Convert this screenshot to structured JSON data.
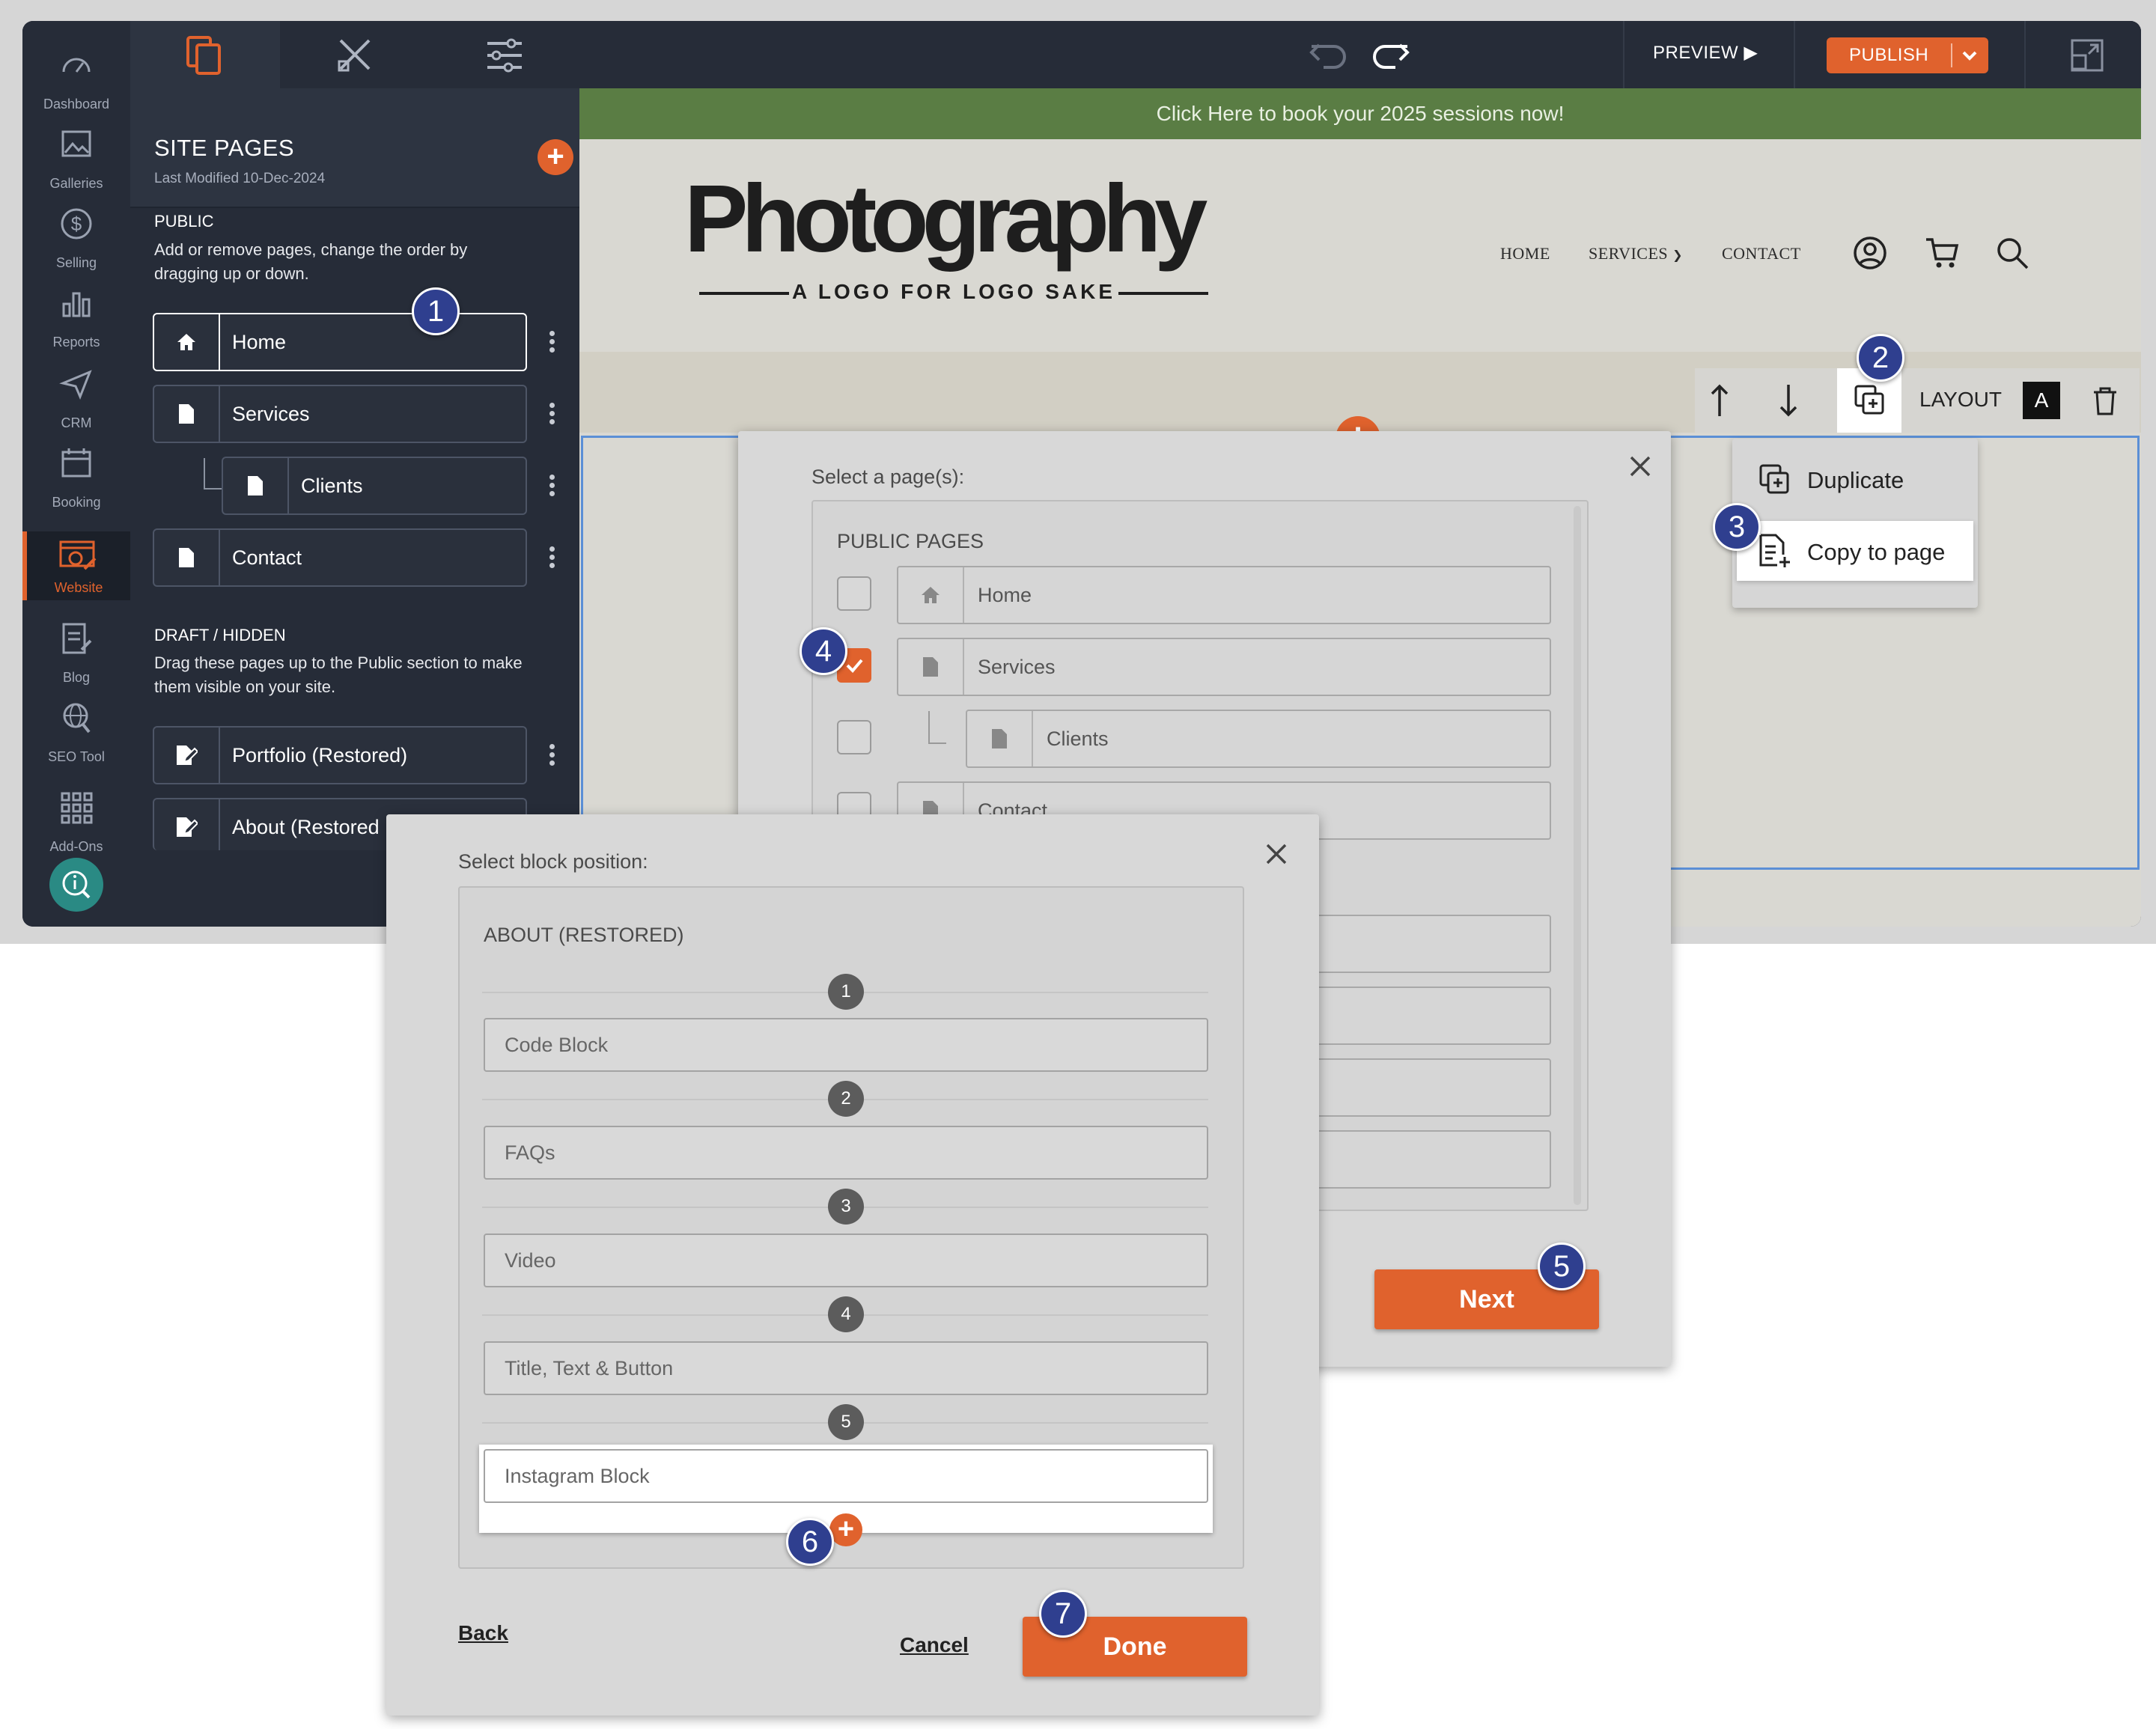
{
  "rail": {
    "items": [
      {
        "label": "Dashboard",
        "icon": "gauge-icon"
      },
      {
        "label": "Galleries",
        "icon": "image-icon"
      },
      {
        "label": "Selling",
        "icon": "dollar-icon"
      },
      {
        "label": "Reports",
        "icon": "bar-chart-icon"
      },
      {
        "label": "CRM",
        "icon": "send-icon"
      },
      {
        "label": "Booking",
        "icon": "calendar-icon"
      },
      {
        "label": "Website",
        "icon": "website-icon",
        "active": true
      },
      {
        "label": "Blog",
        "icon": "blog-icon"
      },
      {
        "label": "SEO Tool",
        "icon": "seo-icon"
      },
      {
        "label": "Add-Ons",
        "icon": "grid-icon"
      }
    ]
  },
  "topbar": {
    "preview_label": "PREVIEW ▶",
    "publish_label": "PUBLISH"
  },
  "sidebar": {
    "title": "SITE PAGES",
    "last_modified": "Last Modified 10-Dec-2024",
    "public_heading": "PUBLIC",
    "public_desc": "Add or remove pages, change the order by dragging up or down.",
    "public_pages": [
      {
        "label": "Home",
        "icon": "home-icon"
      },
      {
        "label": "Services",
        "icon": "page-icon"
      },
      {
        "label": "Clients",
        "icon": "page-icon"
      },
      {
        "label": "Contact",
        "icon": "page-icon"
      }
    ],
    "draft_heading": "DRAFT / HIDDEN",
    "draft_desc": "Drag these pages up to the Public section to make them visible on your site.",
    "draft_pages": [
      {
        "label": "Portfolio (Restored)",
        "icon": "edit-page-icon"
      },
      {
        "label": "About (Restored",
        "icon": "edit-page-icon"
      }
    ]
  },
  "site": {
    "banner": "Click Here to book your 2025 sessions now!",
    "logo_title": "Photography",
    "logo_tagline": "A LOGO FOR LOGO SAKE",
    "nav": [
      "HOME",
      "SERVICES",
      "CONTACT"
    ]
  },
  "block_toolbar": {
    "layout_label": "LAYOUT",
    "layout_value": "A"
  },
  "block_menu": {
    "items": [
      "Duplicate",
      "Copy to page"
    ]
  },
  "page_modal": {
    "title": "Select a page(s):",
    "section": "PUBLIC PAGES",
    "rows": [
      {
        "label": "Home",
        "checked": false
      },
      {
        "label": "Services",
        "checked": true
      },
      {
        "label": "Clients",
        "checked": false
      },
      {
        "label": "Contact",
        "checked": false
      }
    ],
    "next_label": "Next"
  },
  "block_modal": {
    "title": "Select block position:",
    "page_name": "ABOUT (RESTORED)",
    "positions": [
      "1",
      "2",
      "3",
      "4",
      "5"
    ],
    "blocks": [
      "Code Block",
      "FAQs",
      "Video",
      "Title, Text & Button",
      "Instagram Block"
    ],
    "back_label": "Back",
    "cancel_label": "Cancel",
    "done_label": "Done"
  },
  "steps": [
    "1",
    "2",
    "3",
    "4",
    "5",
    "6",
    "7"
  ],
  "colors": {
    "accent": "#e0622d",
    "banner": "#5a7d44",
    "badge": "#2f3f8f"
  }
}
